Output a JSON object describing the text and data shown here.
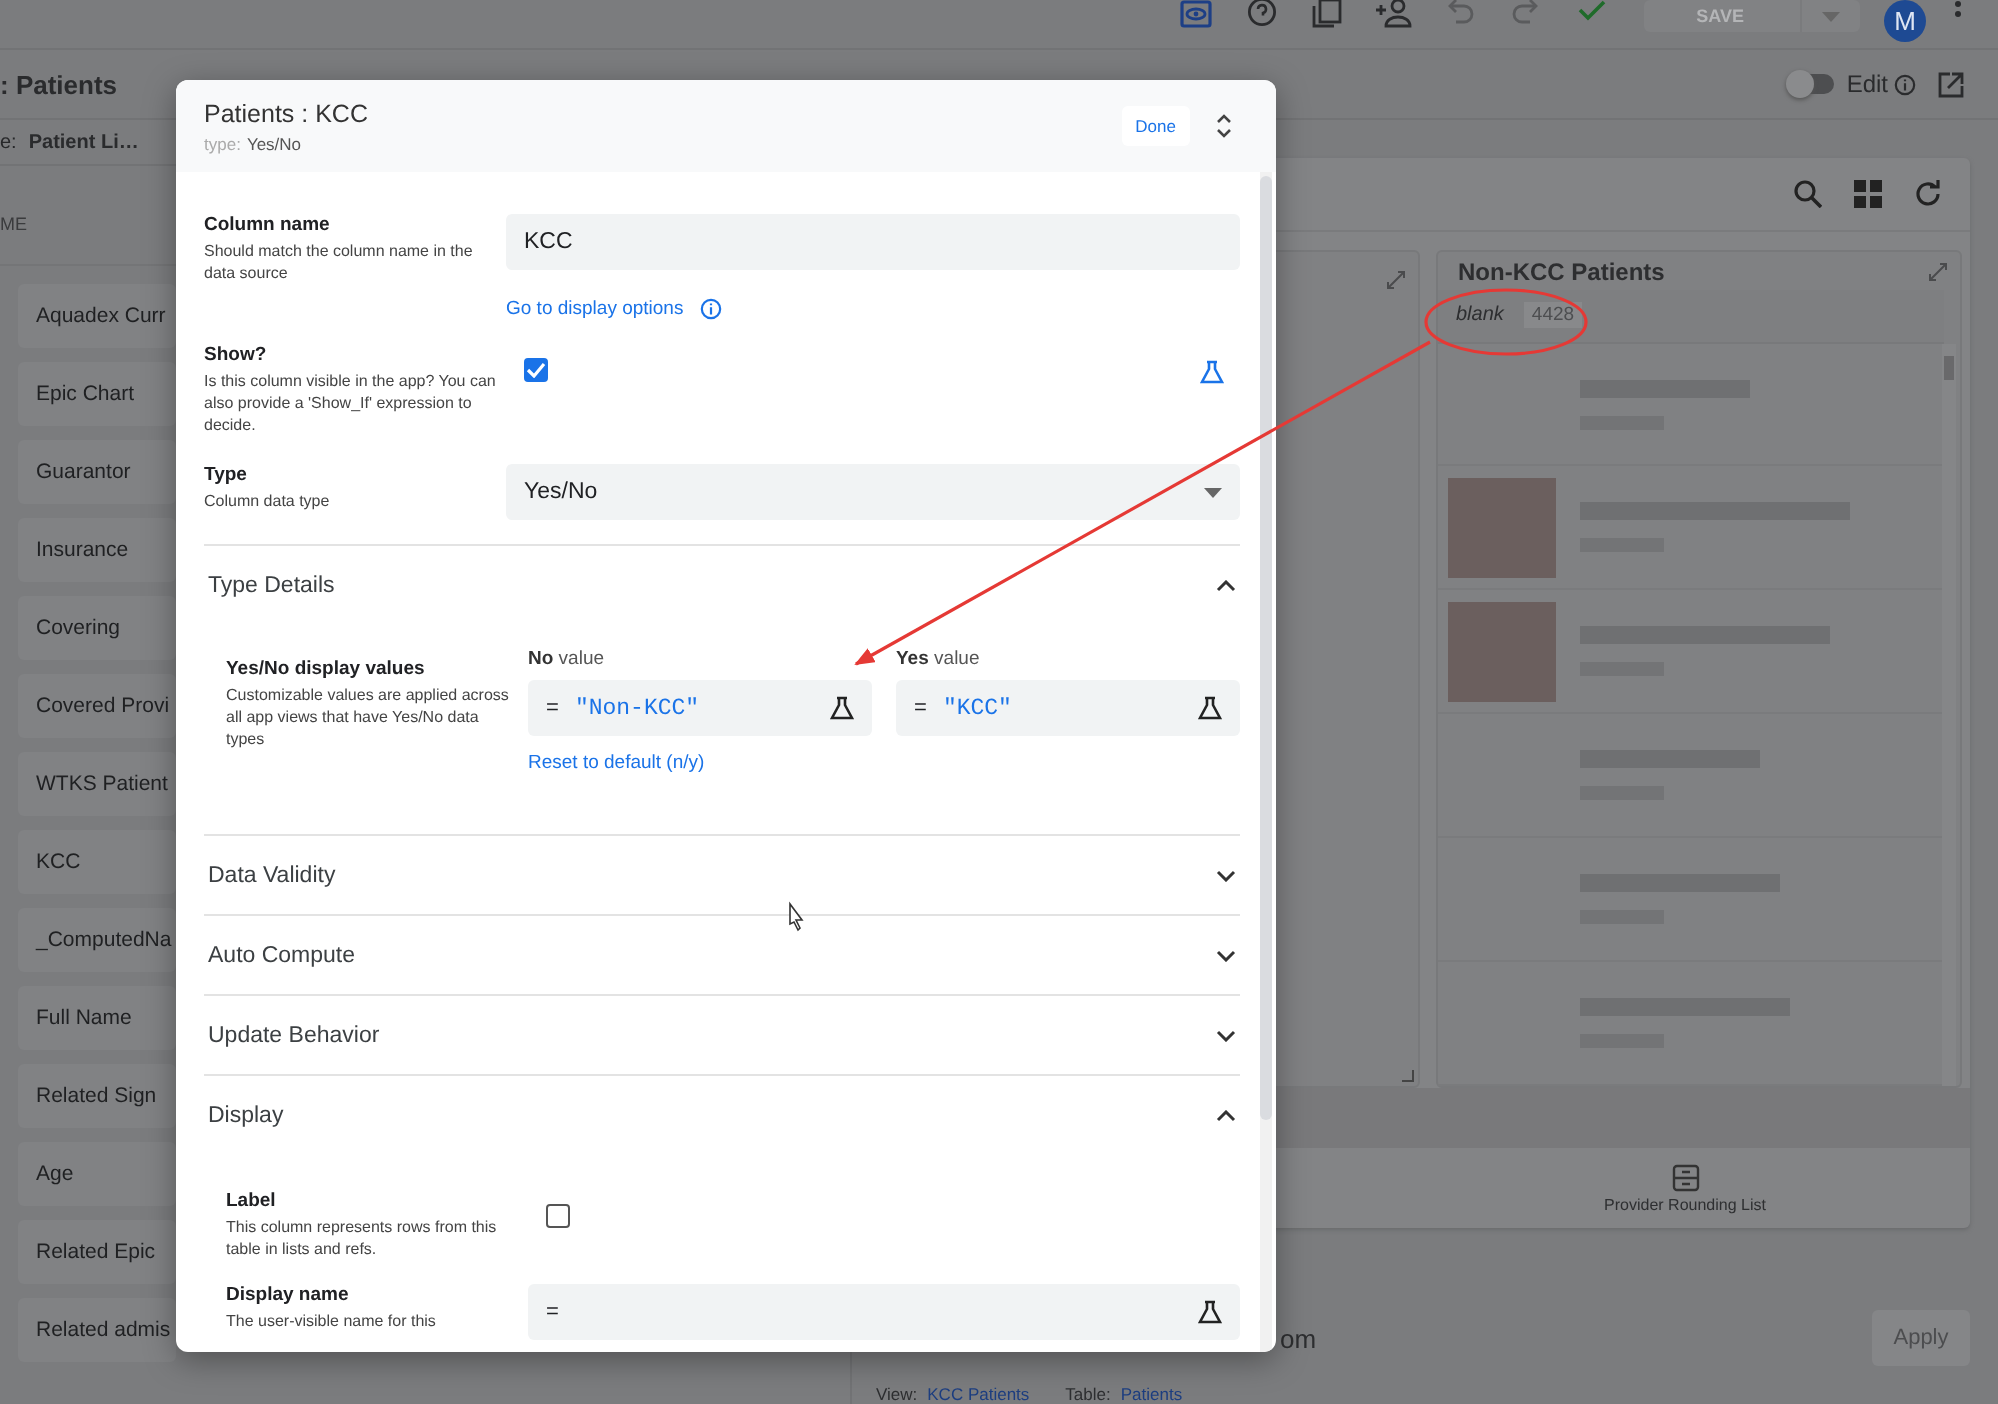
{
  "top_bar": {
    "save_label": "SAVE",
    "avatar": "M"
  },
  "view_bar": {
    "title": ": Patients",
    "edit_label": "Edit",
    "edit_on": false
  },
  "filter_bar": {
    "prefix": "e:",
    "value": "Patient Li…",
    "column_header": "ME"
  },
  "column_list": [
    "Aquadex Curr",
    "Epic Chart",
    "Guarantor",
    "Insurance",
    "Covering",
    "Covered Provi",
    "WTKS Patient",
    "KCC",
    "_ComputedNa",
    "Full Name",
    "Related Sign",
    "Age",
    "Related Epic",
    "Related admis"
  ],
  "preview": {
    "list_title": "Non-KCC Patients",
    "group": {
      "label": "blank",
      "count": "4428"
    },
    "nav_item": "Provider Rounding List"
  },
  "bottom": {
    "field_value": "om",
    "apply": "Apply",
    "view_label": "View:",
    "view_value": "KCC Patients",
    "table_label": "Table:",
    "table_value": "Patients"
  },
  "editor": {
    "title": "Patients : KCC",
    "type_label": "type:",
    "type_value": "Yes/No",
    "done": "Done",
    "fields": [
      {
        "kind": "text",
        "label": "Column name",
        "help": "Should match the column name in the data source",
        "value": "KCC",
        "link": "Go to display options"
      },
      {
        "kind": "checkbox",
        "label": "Show?",
        "help": "Is this column visible in the app? You can also provide a 'Show_If' expression to decide.",
        "checked": true,
        "formula_button": true
      },
      {
        "kind": "select",
        "label": "Type",
        "help": "Column data type",
        "value": "Yes/No"
      }
    ],
    "sections": [
      {
        "title": "Type Details",
        "expanded": true,
        "rows": [
          {
            "kind": "pair",
            "label": "Yes/No display values",
            "help": "Customizable values are applied across all app views that have Yes/No data types",
            "values": [
              {
                "caption": "**No** value",
                "operator": "=",
                "expression": "\"Non-KCC\""
              },
              {
                "caption": "**Yes** value",
                "operator": "=",
                "expression": "\"KCC\""
              }
            ],
            "link": "Reset to default (n/y)"
          }
        ]
      },
      {
        "title": "Data Validity",
        "expanded": false
      },
      {
        "title": "Auto Compute",
        "expanded": false
      },
      {
        "title": "Update Behavior",
        "expanded": false
      },
      {
        "title": "Display",
        "expanded": true,
        "rows": [
          {
            "kind": "checkbox",
            "label": "Label",
            "help": "This column represents rows from this table in lists and refs.",
            "checked": false,
            "formula_button": false
          },
          {
            "kind": "expression",
            "label": "Display name",
            "help": "The user-visible name for this",
            "operator": "="
          }
        ]
      }
    ]
  }
}
